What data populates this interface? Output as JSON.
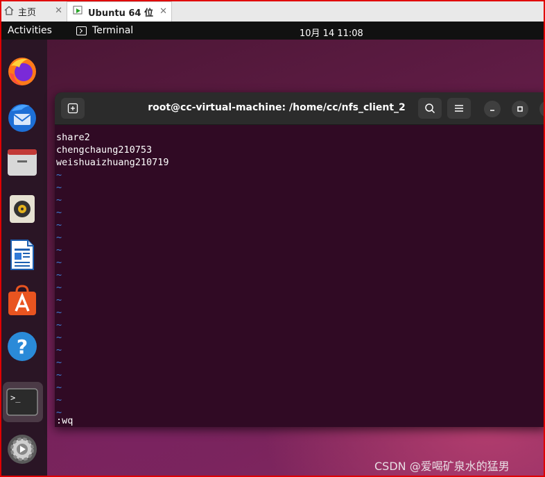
{
  "host_tabs": {
    "home_label": "主页",
    "vm_label": "Ubuntu 64 位",
    "close_glyph": "✕"
  },
  "topbar": {
    "activities": "Activities",
    "app_name": "Terminal",
    "clock": "10月 14  11:08"
  },
  "dock": {
    "items": [
      "firefox",
      "thunderbird",
      "files",
      "rhythmbox",
      "libreoffice-writer",
      "app-center",
      "help",
      "terminal",
      "settings"
    ]
  },
  "terminal": {
    "title": "root@cc-virtual-machine: /home/cc/nfs_client_2",
    "lines": [
      "share2",
      "chengchaung210753",
      "weishuaizhuang210719"
    ],
    "tilde": "~",
    "command": ":wq"
  },
  "watermark": "CSDN @爱喝矿泉水的猛男",
  "colors": {
    "terminal_bg": "#300a24",
    "tilde": "#3f7fd8",
    "frame": "#e00000"
  }
}
